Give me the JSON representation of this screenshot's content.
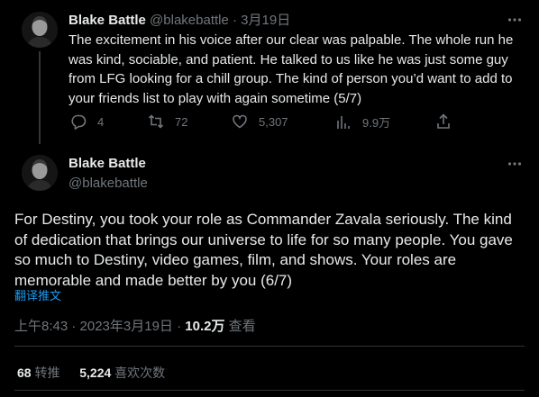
{
  "reply_tweet": {
    "author": {
      "display_name": "Blake Battle",
      "handle": "@blakebattle"
    },
    "separator": "·",
    "date": "3月19日",
    "text": "The excitement in his voice after our clear was palpable. The whole run he was kind, sociable, and patient. He talked to us like he was just some guy from LFG looking for a chill group. The kind of person you’d want to add to your friends list to play with again sometime (5/7)",
    "actions": {
      "replies": "4",
      "retweets": "72",
      "likes": "5,307",
      "views": "9.9万"
    }
  },
  "main_tweet": {
    "author": {
      "display_name": "Blake Battle",
      "handle": "@blakebattle"
    },
    "text": "For Destiny, you took your role as Commander Zavala seriously. The kind of dedication that brings our universe to life for so many people. You gave so much to Destiny, video games, film, and shows. Your roles are memorable and made better by you (6/7)",
    "translate_label": "翻译推文",
    "timestamp": "上午8:43 · 2023年3月19日 · ",
    "views_count": "10.2万",
    "views_label": " 查看",
    "stats": {
      "retweets_count": "68",
      "retweets_label": " 转推",
      "likes_count": "5,224",
      "likes_label": " 喜欢次数"
    }
  },
  "icons": {
    "more": "more-horizontal-icon",
    "reply": "reply-bubble-icon",
    "retweet": "retweet-icon",
    "like": "heart-icon",
    "views": "analytics-bars-icon",
    "share": "share-icon"
  },
  "colors": {
    "background": "#000000",
    "text_primary": "#e7e9ea",
    "text_secondary": "#71767b",
    "link": "#1d9bf0",
    "divider": "#2f3336"
  }
}
